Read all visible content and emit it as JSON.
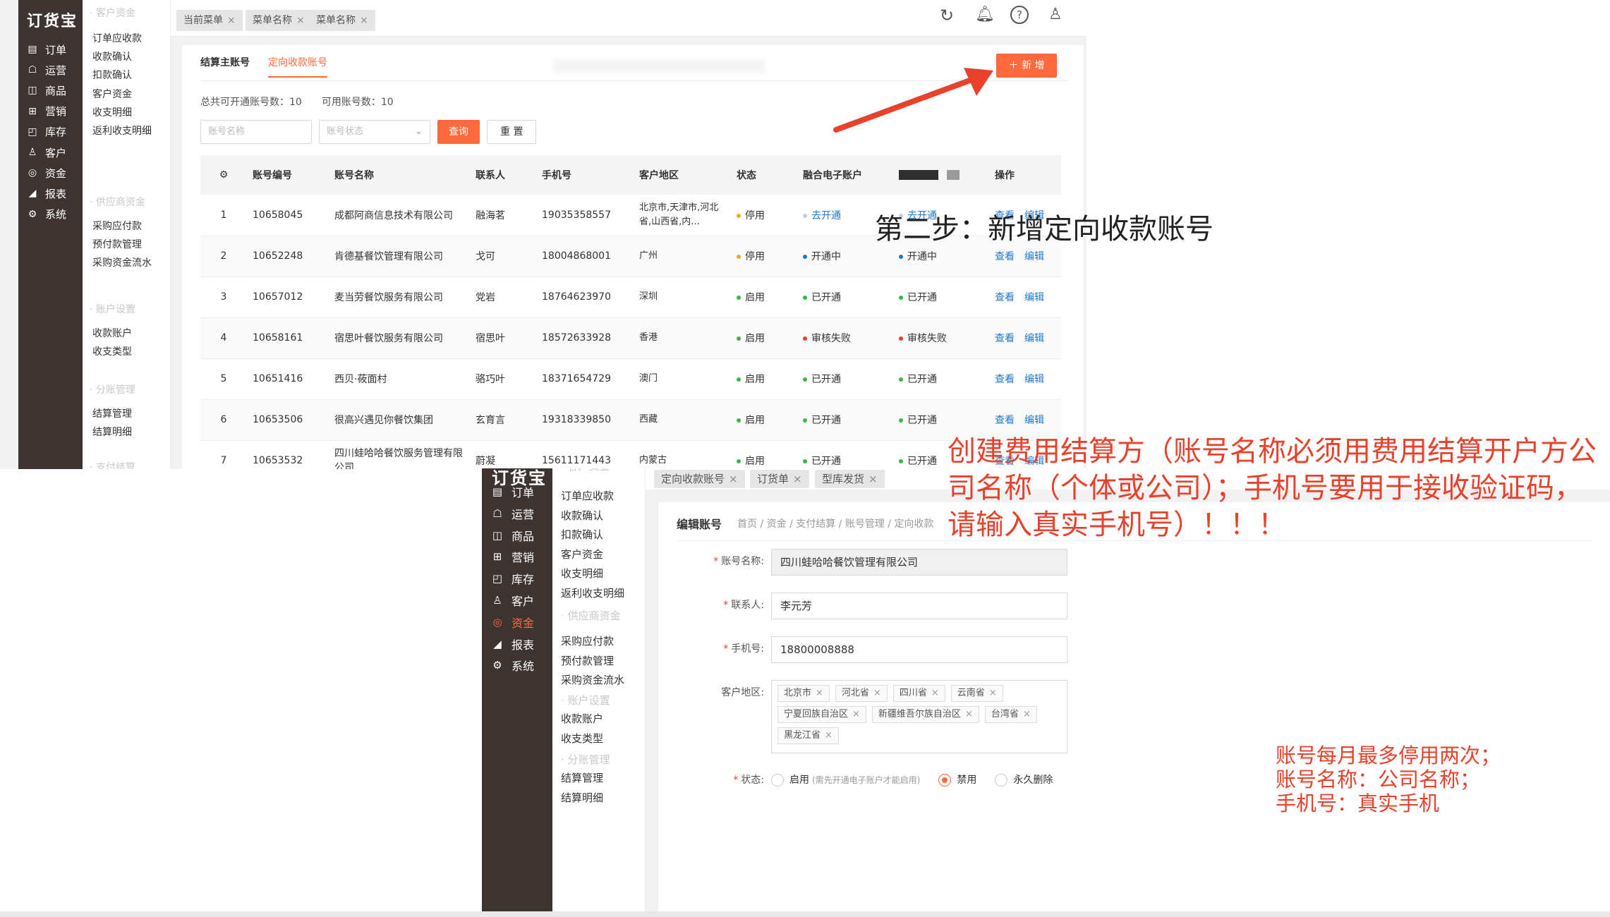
{
  "app": {
    "logo": "订货宝"
  },
  "sidebar_nav": [
    {
      "label": "订单",
      "icon": "▤"
    },
    {
      "label": "运营",
      "icon": "☖"
    },
    {
      "label": "商品",
      "icon": "◫"
    },
    {
      "label": "营销",
      "icon": "⊞"
    },
    {
      "label": "库存",
      "icon": "◰"
    },
    {
      "label": "客户",
      "icon": "♙"
    },
    {
      "label": "资金",
      "icon": "◎"
    },
    {
      "label": "报表",
      "icon": "◢"
    },
    {
      "label": "系统",
      "icon": "⚙"
    }
  ],
  "submenu": {
    "group_customer": "客户资金",
    "customer_items": [
      "订单应收款",
      "收款确认",
      "扣款确认",
      "客户资金",
      "收支明细",
      "返利收支明细"
    ],
    "group_supplier": "供应商资金",
    "supplier_items": [
      "采购应付款",
      "预付款管理",
      "采购资金流水"
    ],
    "group_account": "账户设置",
    "account_items": [
      "收款账户",
      "收支类型"
    ],
    "group_split": "分账管理",
    "split_items": [
      "结算管理",
      "结算明细"
    ],
    "group_pay": "支付结算"
  },
  "top": {
    "tabs": [
      "当前菜单",
      "菜单名称",
      "菜单名称"
    ],
    "header_icons": [
      "refresh-icon",
      "bell-icon",
      "help-icon",
      "user-icon"
    ],
    "inner_tabs": [
      "结算主账号",
      "定向收款账号"
    ],
    "add_button": "＋ 新 增",
    "total_label": "总共可开通账号数：10",
    "avail_label": "可用账号数：10",
    "filter_name_ph": "账号名称",
    "filter_status_ph": "账号状态",
    "btn_query": "查询",
    "btn_reset": "重 置",
    "columns": [
      "账号编号",
      "账号名称",
      "联系人",
      "手机号",
      "客户地区",
      "状态",
      "融合电子账户",
      "",
      "操作"
    ],
    "rows": [
      {
        "no": "1",
        "id": "10658045",
        "name": "成都阿商信息技术有限公司",
        "contact": "融海茗",
        "phone": "19035358557",
        "region": "北京市,天津市,河北省,山西省,内...",
        "status": "停用",
        "status_color": "#f5a623",
        "fusion": "去开通",
        "fusion_color": "#cccccc",
        "fusion_link": true,
        "col8": "去开通",
        "col8_color": "#cccccc",
        "view": "查看",
        "edit": "编辑"
      },
      {
        "no": "2",
        "id": "10652248",
        "name": "肯德基餐饮管理有限公司",
        "contact": "戈可",
        "phone": "18004868001",
        "region": "广州",
        "status": "停用",
        "status_color": "#f5a623",
        "fusion": "开通中",
        "fusion_color": "#1f78d1",
        "fusion_link": false,
        "col8": "开通中",
        "col8_color": "#1f78d1",
        "view": "查看",
        "edit": "编辑"
      },
      {
        "no": "3",
        "id": "10657012",
        "name": "麦当劳餐饮服务有限公司",
        "contact": "党岩",
        "phone": "18764623970",
        "region": "深圳",
        "status": "启用",
        "status_color": "#3bb44a",
        "fusion": "已开通",
        "fusion_color": "#3bb44a",
        "fusion_link": false,
        "col8": "已开通",
        "col8_color": "#3bb44a",
        "view": "查看",
        "edit": "编辑"
      },
      {
        "no": "4",
        "id": "10658161",
        "name": "宿思叶餐饮服务有限公司",
        "contact": "宿思叶",
        "phone": "18572633928",
        "region": "香港",
        "status": "启用",
        "status_color": "#3bb44a",
        "fusion": "审核失败",
        "fusion_color": "#e8412c",
        "fusion_link": false,
        "col8": "审核失败",
        "col8_color": "#e8412c",
        "view": "查看",
        "edit": "编辑"
      },
      {
        "no": "5",
        "id": "10651416",
        "name": "西贝·莜面村",
        "contact": "骆巧叶",
        "phone": "18371654729",
        "region": "澳门",
        "status": "启用",
        "status_color": "#3bb44a",
        "fusion": "已开通",
        "fusion_color": "#3bb44a",
        "fusion_link": false,
        "col8": "已开通",
        "col8_color": "#3bb44a",
        "view": "查看",
        "edit": "编辑"
      },
      {
        "no": "6",
        "id": "10653506",
        "name": "很高兴遇见你餐饮集团",
        "contact": "玄育言",
        "phone": "19318339850",
        "region": "西藏",
        "status": "启用",
        "status_color": "#3bb44a",
        "fusion": "已开通",
        "fusion_color": "#3bb44a",
        "fusion_link": false,
        "col8": "已开通",
        "col8_color": "#3bb44a",
        "view": "查看",
        "edit": "编辑"
      },
      {
        "no": "7",
        "id": "10653532",
        "name": "四川蛙哈哈餐饮服务管理有限公司",
        "contact": "蔚凝",
        "phone": "15611171443",
        "region": "内蒙古",
        "status": "启用",
        "status_color": "#3bb44a",
        "fusion": "已开通",
        "fusion_color": "#3bb44a",
        "fusion_link": false,
        "col8": "已开通",
        "col8_color": "#3bb44a",
        "view": "查看",
        "edit": "编辑"
      }
    ]
  },
  "bottom": {
    "tabs": [
      "定向收款账号",
      "订货单",
      "型库发货"
    ],
    "page_title": "编辑账号",
    "breadcrumb": "首页 / 资金 / 支付结算 / 账号管理 / 定向收款",
    "form": {
      "name_label": "账号名称:",
      "name_value": "四川蛙哈哈餐饮管理有限公司",
      "contact_label": "联系人:",
      "contact_value": "李元芳",
      "phone_label": "手机号:",
      "phone_value": "18800008888",
      "region_label": "客户地区:",
      "region_tags": [
        "北京市",
        "河北省",
        "四川省",
        "云南省",
        "宁夏回族自治区",
        "新疆维吾尔族自治区",
        "台湾省",
        "黑龙江省"
      ],
      "status_label": "状态:",
      "status_options": [
        {
          "label": "启用",
          "hint": "(需先开通电子账户才能启用)",
          "selected": false
        },
        {
          "label": "禁用",
          "hint": "",
          "selected": true
        },
        {
          "label": "永久删除",
          "hint": "",
          "selected": false
        }
      ]
    }
  },
  "annotations": {
    "step2": "第二步：新增定向收款账号",
    "warning": "创建费用结算方（账号名称必须用费用结算开户方公司名称（个体或公司）；手机号要用于接收验证码，请输入真实手机号）！！！",
    "rules": [
      "账号每月最多停用两次；",
      "账号名称：公司名称；",
      "手机号：真实手机"
    ]
  },
  "colors": {
    "accent": "#ff6a3d",
    "sidebar": "#3d3432",
    "annotation_red": "#e8412c",
    "link_blue": "#1f78d1"
  }
}
